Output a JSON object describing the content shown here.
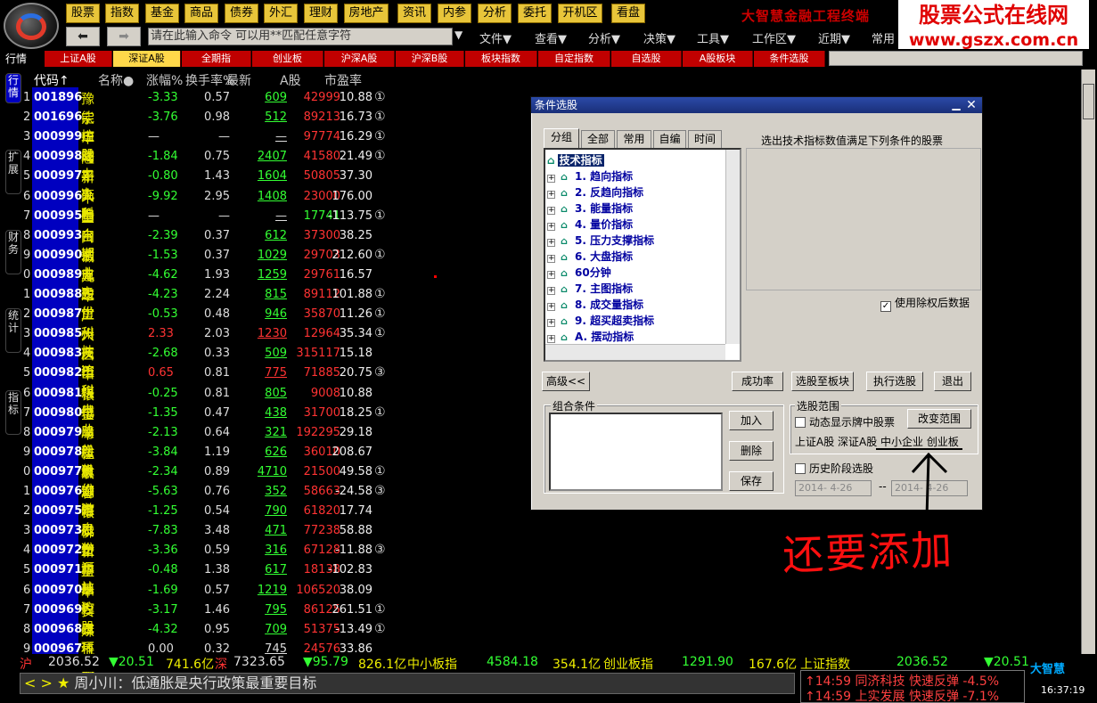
{
  "topbar": {
    "buttons": [
      "股票",
      "指数",
      "基金",
      "商品",
      "债券",
      "外汇",
      "理财",
      "房地产",
      "资讯",
      "内参",
      "分析",
      "委托",
      "开机区",
      "看盘"
    ],
    "title": "大智慧金融工程终端"
  },
  "watermark": {
    "line1": "股票公式在线网",
    "line2": "www.gszx.com.cn"
  },
  "commandbar": {
    "back": "⬅",
    "forward": "➡",
    "input_value": "请在此输入命令   可以用**匹配任意字符",
    "arrow": "▼",
    "menus": [
      "文件▼",
      "查看▼",
      "分析▼",
      "决策▼",
      "工具▼",
      "工作区▼",
      "近期▼",
      "常用"
    ]
  },
  "tabs": {
    "label": "行情",
    "items": [
      "上证A股",
      "深证A股",
      "全期指",
      "创业板",
      "沪深A股",
      "沪深B股",
      "板块指数",
      "自定指数",
      "自选股",
      "A股板块",
      "条件选股"
    ],
    "active": 1
  },
  "side_tabs": [
    "行情",
    "扩展",
    "财务",
    "统计",
    "指标"
  ],
  "table": {
    "headers": {
      "code": "代码↑",
      "name": "名称●",
      "chg": "涨幅%",
      "turn": "换手率%",
      "latest": "最新",
      "ashare": "A股",
      "pe": "市盈率"
    },
    "rows": [
      {
        "i": "1",
        "code": "001896",
        "name": "豫能控股",
        "chg": "-3.33",
        "turn": "0.57",
        "latest": "609",
        "ashare": "42999",
        "pe": "10.88",
        "mark": "①",
        "lc": "#3f3",
        "ac": "#f33"
      },
      {
        "i": "2",
        "code": "001696",
        "name": "宗申动力¤",
        "chg": "-3.76",
        "turn": "0.98",
        "latest": "512",
        "ashare": "89213",
        "pe": "16.73",
        "mark": "①",
        "lc": "#3f3",
        "ac": "#f33"
      },
      {
        "i": "3",
        "code": "000999",
        "name": "华润三九¤",
        "chg": "—",
        "turn": "—",
        "latest": "—",
        "ashare": "97774",
        "pe": "16.29",
        "mark": "①",
        "lc": "#ddd",
        "ac": "#f33"
      },
      {
        "i": "4",
        "code": "000998",
        "name": "隆平高科",
        "chg": "-1.84",
        "turn": "0.75",
        "latest": "2407",
        "ashare": "41580",
        "pe": "21.49",
        "mark": "①",
        "lc": "#3f3",
        "ac": "#f33"
      },
      {
        "i": "5",
        "code": "000997",
        "name": "新 大 陆",
        "chg": "-0.80",
        "turn": "1.43",
        "latest": "1604",
        "ashare": "50805",
        "pe": "37.30",
        "mark": "",
        "lc": "#3f3",
        "ac": "#f33"
      },
      {
        "i": "6",
        "code": "000996",
        "name": "中国中期",
        "chg": "-9.92",
        "turn": "2.95",
        "latest": "1408",
        "ashare": "23000",
        "pe": "176.00",
        "mark": "",
        "lc": "#3f3",
        "ac": "#f33"
      },
      {
        "i": "7",
        "code": "000995",
        "name": "皇台酒业¤",
        "chg": "—",
        "turn": "—",
        "latest": "—",
        "ashare": "17741",
        "pe": "-113.75",
        "mark": "①",
        "lc": "#ddd",
        "ac": "#3f3"
      },
      {
        "i": "8",
        "code": "000993",
        "name": "闽东电力",
        "chg": "-2.39",
        "turn": "0.37",
        "latest": "612",
        "ashare": "37300",
        "pe": "38.25",
        "mark": "",
        "lc": "#3f3",
        "ac": "#f33"
      },
      {
        "i": "9",
        "code": "000990",
        "name": "诚志股份",
        "chg": "-1.53",
        "turn": "0.37",
        "latest": "1029",
        "ashare": "29703",
        "pe": "212.60",
        "mark": "①",
        "lc": "#3f3",
        "ac": "#f33"
      },
      {
        "i": "0",
        "code": "000989",
        "name": "九 芝 堂",
        "chg": "-4.62",
        "turn": "1.93",
        "latest": "1259",
        "ashare": "29761",
        "pe": "16.57",
        "mark": "",
        "lc": "#3f3",
        "ac": "#f33"
      },
      {
        "i": "1",
        "code": "000988",
        "name": "华工科技¤",
        "chg": "-4.23",
        "turn": "2.24",
        "latest": "815",
        "ashare": "89112",
        "pe": "101.88",
        "mark": "①",
        "lc": "#3f3",
        "ac": "#f33"
      },
      {
        "i": "2",
        "code": "000987",
        "name": "广州友谊",
        "chg": "-0.53",
        "turn": "0.48",
        "latest": "946",
        "ashare": "35870",
        "pe": "11.26",
        "mark": "①",
        "lc": "#3f3",
        "ac": "#f33"
      },
      {
        "i": "3",
        "code": "000985",
        "name": "大庆华科",
        "chg": "2.33",
        "turn": "2.03",
        "latest": "1230",
        "ashare": "12964",
        "pe": "35.34",
        "mark": "①",
        "lc": "#f33",
        "ac": "#f33"
      },
      {
        "i": "4",
        "code": "000983",
        "name": "西山煤电",
        "chg": "-2.68",
        "turn": "0.33",
        "latest": "509",
        "ashare": "315117",
        "pe": "15.18",
        "mark": "",
        "lc": "#3f3",
        "ac": "#f33"
      },
      {
        "i": "5",
        "code": "000982",
        "name": "中银绒业",
        "chg": "0.65",
        "turn": "0.81",
        "latest": "775",
        "ashare": "71885",
        "pe": "20.75",
        "mark": "③",
        "lc": "#f33",
        "ac": "#f33"
      },
      {
        "i": "6",
        "code": "000981",
        "name": "银亿股份¤",
        "chg": "-0.25",
        "turn": "0.81",
        "latest": "805",
        "ashare": "9008",
        "pe": "10.88",
        "mark": "",
        "lc": "#3f3",
        "ac": "#f33"
      },
      {
        "i": "7",
        "code": "000980",
        "name": "金马股份",
        "chg": "-1.35",
        "turn": "0.47",
        "latest": "438",
        "ashare": "31700",
        "pe": "18.25",
        "mark": "①",
        "lc": "#3f3",
        "ac": "#f33"
      },
      {
        "i": "8",
        "code": "000979",
        "name": "中弘股份¤",
        "chg": "-2.13",
        "turn": "0.64",
        "latest": "321",
        "ashare": "192295",
        "pe": "29.18",
        "mark": "",
        "lc": "#3f3",
        "ac": "#f33"
      },
      {
        "i": "9",
        "code": "000978",
        "name": "桂林旅游",
        "chg": "-3.84",
        "turn": "1.19",
        "latest": "626",
        "ashare": "36010",
        "pe": "208.67",
        "mark": "",
        "lc": "#3f3",
        "ac": "#f33"
      },
      {
        "i": "0",
        "code": "000977",
        "name": "浪潮信息¤",
        "chg": "-2.34",
        "turn": "0.89",
        "latest": "4710",
        "ashare": "21500",
        "pe": "49.58",
        "mark": "①",
        "lc": "#3f3",
        "ac": "#f33"
      },
      {
        "i": "1",
        "code": "000976",
        "name": "春晖股份",
        "chg": "-5.63",
        "turn": "0.76",
        "latest": "352",
        "ashare": "58663",
        "pe": "-24.58",
        "mark": "③",
        "lc": "#3f3",
        "ac": "#f33"
      },
      {
        "i": "2",
        "code": "000975",
        "name": "银泰资源",
        "chg": "-1.25",
        "turn": "0.54",
        "latest": "790",
        "ashare": "61820",
        "pe": "17.74",
        "mark": "",
        "lc": "#3f3",
        "ac": "#f33"
      },
      {
        "i": "3",
        "code": "000973",
        "name": "佛塑科技¤",
        "chg": "-7.83",
        "turn": "3.48",
        "latest": "471",
        "ashare": "77238",
        "pe": "58.88",
        "mark": "",
        "lc": "#3f3",
        "ac": "#f33"
      },
      {
        "i": "4",
        "code": "000972",
        "name": "新中基",
        "chg": "-3.36",
        "turn": "0.59",
        "latest": "316",
        "ashare": "67128",
        "pe": "-11.88",
        "mark": "③",
        "lc": "#3f3",
        "ac": "#f33"
      },
      {
        "i": "5",
        "code": "000971",
        "name": "蓝鼎控股",
        "chg": "-0.48",
        "turn": "1.38",
        "latest": "617",
        "ashare": "18138",
        "pe": "-102.83",
        "mark": "",
        "lc": "#3f3",
        "ac": "#f33"
      },
      {
        "i": "6",
        "code": "000970",
        "name": "中科三环",
        "chg": "-1.69",
        "turn": "0.57",
        "latest": "1219",
        "ashare": "106520",
        "pe": "38.09",
        "mark": "",
        "lc": "#3f3",
        "ac": "#f33"
      },
      {
        "i": "7",
        "code": "000969",
        "name": "安泰科技",
        "chg": "-3.17",
        "turn": "1.46",
        "latest": "795",
        "ashare": "86125",
        "pe": "261.51",
        "mark": "①",
        "lc": "#3f3",
        "ac": "#f33"
      },
      {
        "i": "8",
        "code": "000968",
        "name": "煤 气 化",
        "chg": "-4.32",
        "turn": "0.95",
        "latest": "709",
        "ashare": "51375",
        "pe": "-13.49",
        "mark": "①",
        "lc": "#3f3",
        "ac": "#f33"
      },
      {
        "i": "9",
        "code": "000967",
        "name": "上风高科",
        "chg": "0.00",
        "turn": "0.32",
        "latest": "745",
        "ashare": "24576",
        "pe": "33.86",
        "mark": "",
        "lc": "#ddd",
        "ac": "#f33"
      }
    ]
  },
  "index_bar": [
    {
      "t": "沪",
      "c": "#f33"
    },
    {
      "t": "2036.52",
      "c": "#ddd"
    },
    {
      "t": "▼20.51",
      "c": "#3f3"
    },
    {
      "t": "741.6亿",
      "c": "#ee0"
    },
    {
      "t": "深",
      "c": "#f33"
    },
    {
      "t": "7323.65",
      "c": "#ddd"
    },
    {
      "t": "▼95.79",
      "c": "#3f3"
    },
    {
      "t": "826.1亿",
      "c": "#ee0"
    },
    {
      "t": "中小板指",
      "c": "#ee0"
    },
    {
      "t": "4584.18",
      "c": "#3f3"
    },
    {
      "t": "354.1亿",
      "c": "#ee0"
    },
    {
      "t": "创业板指",
      "c": "#ee0"
    },
    {
      "t": "1291.90",
      "c": "#3f3"
    },
    {
      "t": "167.6亿",
      "c": "#ee0"
    },
    {
      "t": "上证指数",
      "c": "#ee0"
    },
    {
      "t": "2036.52",
      "c": "#3f3"
    },
    {
      "t": "▼20.51",
      "c": "#3f3"
    }
  ],
  "news": "周小川：低通胀是央行政策最重要目标",
  "news_prefix": "< > ★",
  "alerts": [
    "↑14:59 同济科技 快速反弹 -4.5%",
    "↑14:59 上实发展 快速反弹 -7.1%"
  ],
  "app_logo": "大智慧",
  "clock": "16:37:19",
  "dialog": {
    "title": "条件选股",
    "tabs": [
      "分组",
      "全部",
      "常用",
      "自编",
      "时间"
    ],
    "tree_root": "技术指标",
    "tree_items": [
      "1. 趋向指标",
      "2. 反趋向指标",
      "3. 能量指标",
      "4. 量价指标",
      "5. 压力支撑指标",
      "6. 大盘指标",
      "60分钟",
      "7. 主图指标",
      "8. 成交量指标",
      "9. 超买超卖指标",
      "A. 摆动指标"
    ],
    "desc": "选出技术指标数值满足下列条件的股票",
    "use_adjusted": "使用除权后数据",
    "buttons": {
      "advanced": "高级<<",
      "success": "成功率",
      "to_block": "选股至板块",
      "run": "执行选股",
      "exit": "退出",
      "add": "加入",
      "delete": "删除",
      "save": "保存",
      "change_range": "改变范围"
    },
    "combo_label": "组合条件",
    "range_label": "选股范围",
    "dynamic_label": "动态显示牌中股票",
    "range_text": "上证A股 深证A股 中小企业 创业板",
    "history_label": "历史阶段选股",
    "date_from": "2014- 4-26",
    "date_to": "2014- 4-26",
    "date_sep": "--"
  },
  "annotation": "还要添加"
}
